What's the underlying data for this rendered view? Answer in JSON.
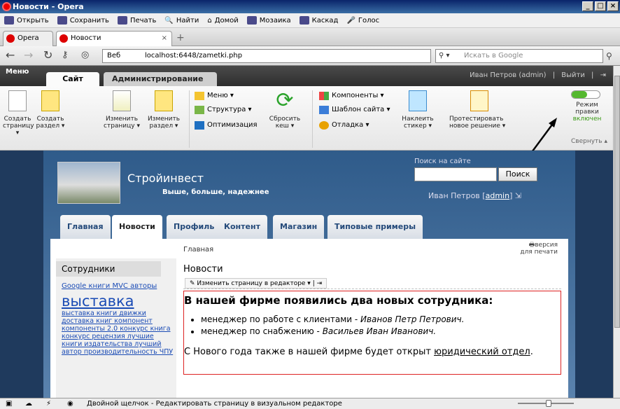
{
  "window": {
    "title": "Новости - Opera"
  },
  "menubar": {
    "items": [
      "Открыть",
      "Сохранить",
      "Печать",
      "Найти",
      "Домой",
      "Мозаика",
      "Каскад",
      "Голос"
    ]
  },
  "tabs": {
    "opera_btn": "Opera",
    "active_tab": "Новости",
    "close": "×",
    "new_tab": "+"
  },
  "address": {
    "web_label": "Веб",
    "url": "localhost:6448/zametki.php",
    "search_placeholder": "Искать в Google"
  },
  "admin": {
    "menu_label": "Меню",
    "tab_site": "Сайт",
    "tab_admin": "Администрирование",
    "user": "Иван Петров (admin)",
    "logout": "Выйти"
  },
  "ribbon": {
    "create_page": [
      "Создать",
      "страницу ▾"
    ],
    "create_section": [
      "Создать",
      "раздел ▾"
    ],
    "edit_page": [
      "Изменить",
      "страницу ▾"
    ],
    "edit_section": [
      "Изменить",
      "раздел ▾"
    ],
    "menu": "Меню ▾",
    "structure": "Структура ▾",
    "seo": "Оптимизация",
    "reset_cache": [
      "Сбросить",
      "кеш ▾"
    ],
    "components": "Компоненты ▾",
    "template": "Шаблон сайта ▾",
    "debug": "Отладка ▾",
    "sticker": [
      "Наклеить",
      "стикер ▾"
    ],
    "test": [
      "Протестировать",
      "новое решение ▾"
    ],
    "edit_mode": [
      "Режим правки",
      "включен"
    ],
    "collapse": "Свернуть ▴"
  },
  "site": {
    "name": "Стройинвест",
    "slogan": "Выше, больше, надежнее",
    "search_label": "Поиск на сайте",
    "search_button": "Поиск",
    "user_name": "Иван Петров",
    "user_link": "admin",
    "nav": [
      "Главная",
      "Новости",
      "Профиль",
      "Контент",
      "Магазин",
      "Типовые примеры"
    ],
    "breadcrumb": "Главная",
    "print_version": [
      "версия",
      "для печати"
    ],
    "page_heading": "Новости",
    "edit_page_btn": "Изменить страницу в редакторе ▾",
    "sidebar_heading": "Сотрудники",
    "tags_top": "Google книги MVC авторы",
    "tag_big": "выставка",
    "tags_rest": "выставка книги движки доставка книг компонент компоненты 2.0 конкурс книга конкурс рецензия лучшие книги издательства лучший автор производительность ЧПУ",
    "article_title": "В нашей фирме появились два новых сотрудника:",
    "bullet1_prefix": "менеджер по работе с клиентами - ",
    "bullet1_name": "Иванов Петр Петрович.",
    "bullet2_prefix": "менеджер по снабжению - ",
    "bullet2_name": "Васильев Иван Иванович.",
    "para_prefix": "С Нового года также в нашей фирме будет открыт ",
    "para_link": "юридический отдел",
    "para_suffix": "."
  },
  "statusbar": {
    "text": "Двойной щелчок - Редактировать страницу в визуальном редакторе"
  }
}
